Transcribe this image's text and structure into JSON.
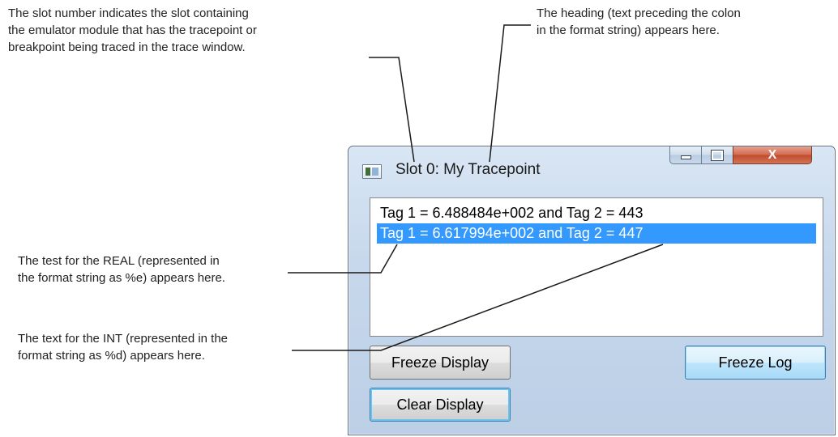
{
  "callouts": {
    "slot": "The slot number indicates the slot containing\nthe emulator module that has the tracepoint or\nbreakpoint being traced in the trace window.",
    "heading": "The heading (text preceding the colon\nin the format string) appears here.",
    "real": "The test for the REAL (represented in\nthe format string as %e) appears here.",
    "int": "The text for the INT (represented in the\nformat string as %d) appears here."
  },
  "window": {
    "title": "Slot 0: My Tracepoint",
    "close_label": "X",
    "icon": "app-window-icon"
  },
  "trace_list": {
    "rows": [
      {
        "text": "Tag 1 = 6.488484e+002 and Tag 2 = 443",
        "selected": false
      },
      {
        "text": "Tag 1 = 6.617994e+002 and Tag 2 = 447",
        "selected": true
      }
    ],
    "selection_color": "#3399ff"
  },
  "buttons": {
    "freeze_display": "Freeze Display",
    "freeze_log": "Freeze Log",
    "clear_display": "Clear Display"
  }
}
